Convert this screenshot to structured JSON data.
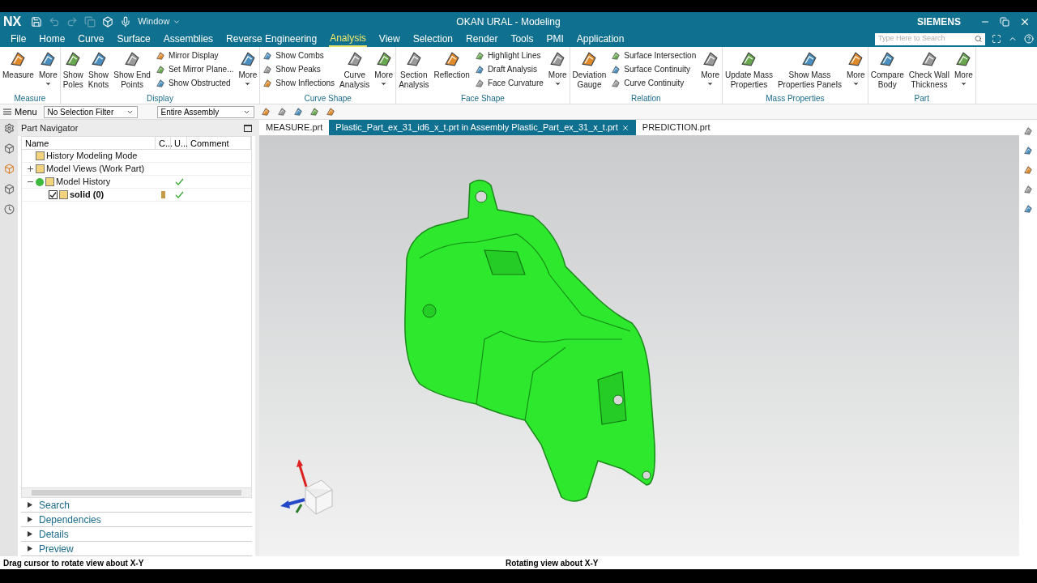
{
  "app": {
    "logo": "NX",
    "title": "OKAN URAL - Modeling",
    "brand": "SIEMENS",
    "window_menu": "Window"
  },
  "menu_tabs": [
    {
      "label": "File",
      "selected": false
    },
    {
      "label": "Home",
      "selected": false
    },
    {
      "label": "Curve",
      "selected": false
    },
    {
      "label": "Surface",
      "selected": false
    },
    {
      "label": "Assemblies",
      "selected": false
    },
    {
      "label": "Reverse Engineering",
      "selected": false
    },
    {
      "label": "Analysis",
      "selected": true
    },
    {
      "label": "View",
      "selected": false
    },
    {
      "label": "Selection",
      "selected": false
    },
    {
      "label": "Render",
      "selected": false
    },
    {
      "label": "Tools",
      "selected": false
    },
    {
      "label": "PMI",
      "selected": false
    },
    {
      "label": "Application",
      "selected": false
    }
  ],
  "search": {
    "placeholder": "Type Here to Search"
  },
  "ribbon": [
    {
      "title": "Measure",
      "items": [
        {
          "kind": "large",
          "lines": [
            "Measure"
          ]
        },
        {
          "kind": "more",
          "lines": [
            "More"
          ]
        }
      ]
    },
    {
      "title": "Display",
      "items": [
        {
          "kind": "large",
          "lines": [
            "Show",
            "Poles"
          ]
        },
        {
          "kind": "large",
          "lines": [
            "Show",
            "Knots"
          ]
        },
        {
          "kind": "large",
          "lines": [
            "Show End",
            "Points"
          ]
        },
        {
          "kind": "stack",
          "entries": [
            "Mirror Display",
            "Set Mirror Plane...",
            "Show Obstructed"
          ]
        },
        {
          "kind": "more",
          "lines": [
            "More"
          ]
        }
      ]
    },
    {
      "title": "Curve Shape",
      "items": [
        {
          "kind": "stack",
          "entries": [
            "Show Combs",
            "Show Peaks",
            "Show Inflections"
          ]
        },
        {
          "kind": "large",
          "lines": [
            "Curve",
            "Analysis"
          ]
        },
        {
          "kind": "more",
          "lines": [
            "More"
          ]
        }
      ]
    },
    {
      "title": "Face Shape",
      "items": [
        {
          "kind": "large",
          "lines": [
            "Section",
            "Analysis"
          ]
        },
        {
          "kind": "large",
          "lines": [
            "Reflection"
          ]
        },
        {
          "kind": "stack",
          "entries": [
            "Highlight Lines",
            "Draft Analysis",
            "Face Curvature"
          ]
        },
        {
          "kind": "more",
          "lines": [
            "More"
          ]
        }
      ]
    },
    {
      "title": "Relation",
      "items": [
        {
          "kind": "large",
          "lines": [
            "Deviation",
            "Gauge"
          ]
        },
        {
          "kind": "stack",
          "entries": [
            "Surface Intersection",
            "Surface Continuity",
            "Curve Continuity"
          ]
        },
        {
          "kind": "more",
          "lines": [
            "More"
          ]
        }
      ]
    },
    {
      "title": "Mass Properties",
      "items": [
        {
          "kind": "large",
          "lines": [
            "Update Mass",
            "Properties"
          ]
        },
        {
          "kind": "large",
          "lines": [
            "Show Mass",
            "Properties Panels"
          ]
        },
        {
          "kind": "more",
          "lines": [
            "More"
          ]
        }
      ]
    },
    {
      "title": "Part",
      "items": [
        {
          "kind": "large",
          "lines": [
            "Compare",
            "Body"
          ]
        },
        {
          "kind": "large",
          "lines": [
            "Check Wall",
            "Thickness"
          ]
        },
        {
          "kind": "more",
          "lines": [
            "More"
          ]
        }
      ]
    }
  ],
  "toolbar": {
    "menu": "Menu",
    "selection_filter": "No Selection Filter",
    "scope": "Entire Assembly"
  },
  "navigator": {
    "title": "Part Navigator",
    "columns": [
      "Name",
      "C...",
      "U...",
      "Comment"
    ],
    "nodes": [
      {
        "name": "History Modeling Mode",
        "expanded": false,
        "has_children": false,
        "up_to_date": false,
        "bold": false
      },
      {
        "name": "Model Views (Work Part)",
        "expanded": false,
        "has_children": true,
        "up_to_date": false,
        "bold": false
      },
      {
        "name": "Model History",
        "expanded": true,
        "has_children": true,
        "up_to_date": true,
        "bold": false,
        "children": [
          {
            "name": "solid (0)",
            "expanded": false,
            "has_children": false,
            "up_to_date": true,
            "bold": true,
            "checked": true
          }
        ]
      }
    ],
    "panels": [
      {
        "label": "Search",
        "expanded": false
      },
      {
        "label": "Dependencies",
        "expanded": false
      },
      {
        "label": "Details",
        "expanded": false
      },
      {
        "label": "Preview",
        "expanded": false
      }
    ]
  },
  "doc_tabs": [
    {
      "label": "MEASURE.prt",
      "selected": false
    },
    {
      "label": "Plastic_Part_ex_31_id6_x_t.prt in Assembly Plastic_Part_ex_31_x_t.prt",
      "selected": true
    },
    {
      "label": "PREDICTION.prt",
      "selected": false
    }
  ],
  "status_bar": {
    "left": "Drag cursor to rotate view about X-Y",
    "center": "Rotating view about X-Y"
  }
}
